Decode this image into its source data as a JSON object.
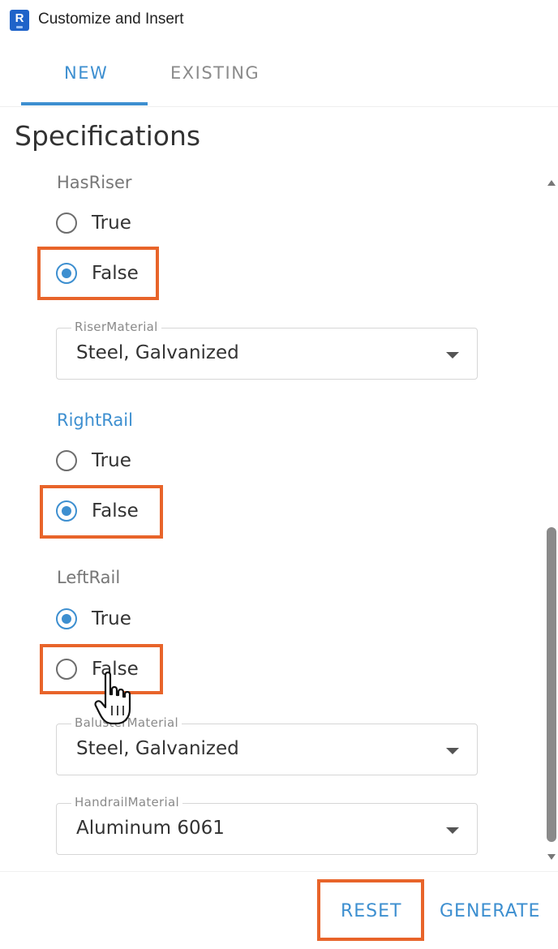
{
  "window": {
    "title": "Customize and Insert",
    "app_icon_letter": "R",
    "app_icon_color": "#1f63c9"
  },
  "tabs": [
    {
      "label": "NEW",
      "active": true
    },
    {
      "label": "EXISTING",
      "active": false
    }
  ],
  "section_title": "Specifications",
  "groups": {
    "has_riser": {
      "label": "HasRiser",
      "options": [
        {
          "label": "True",
          "checked": false
        },
        {
          "label": "False",
          "checked": true
        }
      ],
      "select": {
        "label": "RiserMaterial",
        "value": "Steel, Galvanized"
      }
    },
    "right_rail": {
      "label": "RightRail",
      "options": [
        {
          "label": "True",
          "checked": false
        },
        {
          "label": "False",
          "checked": true
        }
      ]
    },
    "left_rail": {
      "label": "LeftRail",
      "options": [
        {
          "label": "True",
          "checked": true
        },
        {
          "label": "False",
          "checked": false
        }
      ],
      "selects": [
        {
          "label": "BalusterMaterial",
          "value": "Steel, Galvanized"
        },
        {
          "label": "HandrailMaterial",
          "value": "Aluminum 6061"
        }
      ]
    }
  },
  "footer": {
    "reset_label": "RESET",
    "generate_label": "GENERATE"
  },
  "colors": {
    "accent": "#3d8fd0",
    "highlight": "#e8642a"
  },
  "cursor_icon": "hand-pointer-icon"
}
